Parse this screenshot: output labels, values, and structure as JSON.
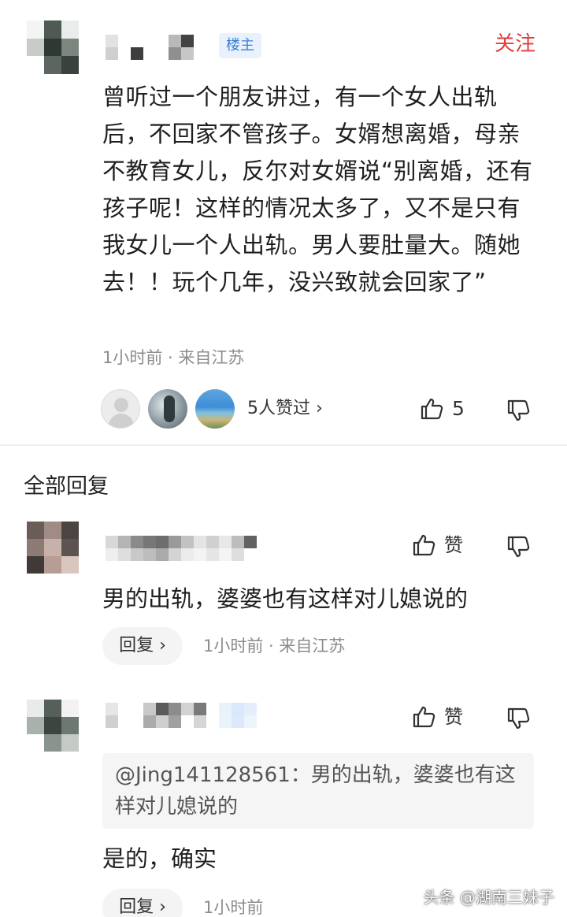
{
  "original_post": {
    "op_tag": "楼主",
    "follow_label": "关注",
    "body": "曾听过一个朋友讲过，有一个女人出轨后，不回家不管孩子。女婿想离婚，母亲不教育女儿，反尔对女婿说“别离婚，还有孩子呢！这样的情况太多了，又不是只有我女儿一个人出轨。男人要肚量大。随她去！！玩个几年，没兴致就会回家了”",
    "meta": "1小时前 · 来自江苏",
    "likers_text": "5人赞过 ›",
    "like_count": "5",
    "icons": [
      "thumbs-up-icon",
      "thumbs-down-icon"
    ]
  },
  "replies_section": {
    "title": "全部回复"
  },
  "replies": [
    {
      "like_label": "赞",
      "body": "男的出轨，婆婆也有这样对儿媳说的",
      "reply_button": "回复 ›",
      "meta": "1小时前 · 来自江苏"
    },
    {
      "like_label": "赞",
      "quote": "@Jing141128561：男的出轨，婆婆也有这样对儿媳说的",
      "body": "是的，确实",
      "reply_button": "回复 ›",
      "meta": "1小时前"
    }
  ],
  "watermark": "头条 @湖南三妹子",
  "colors": {
    "accent_red": "#e23c3c",
    "tag_blue": "#3b7fd6",
    "meta_gray": "#8c8c8c"
  }
}
